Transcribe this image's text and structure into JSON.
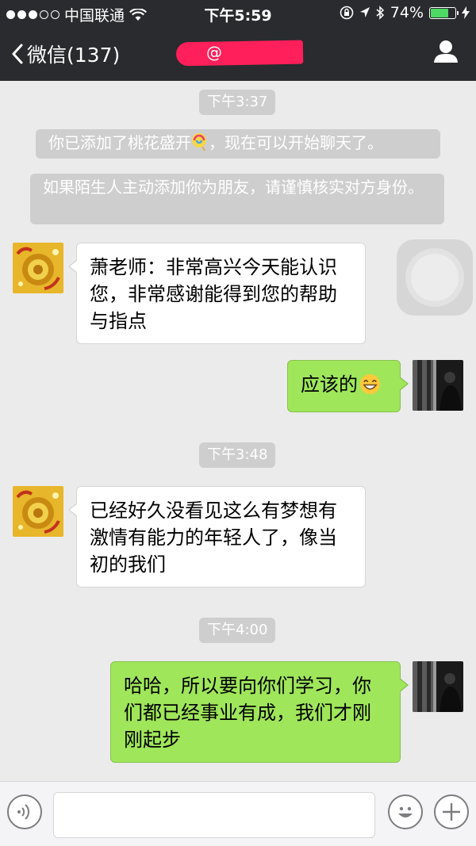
{
  "status_bar": {
    "carrier": "中国联通",
    "time": "下午5:59",
    "battery_percent": "74%",
    "battery_level": 0.74,
    "icons": [
      "signal-dots-icon",
      "wifi-icon",
      "orientation-lock-icon",
      "location-icon",
      "bluetooth-icon",
      "battery-icon",
      "charging-bolt-icon"
    ]
  },
  "nav": {
    "back_label": "微信(137)",
    "title_fragment": "@",
    "profile_icon": "person-icon"
  },
  "chat": {
    "timestamps": [
      "下午3:37",
      "下午3:48",
      "下午4:00"
    ],
    "system_messages": [
      {
        "text_before": "你已添加了桃花盛开",
        "emoji": "lollipop-emoji",
        "text_after": "，现在可以开始聊天了。"
      },
      {
        "text": "如果陌生人主动添加你为朋友，请谨慎核实对方身份。"
      }
    ],
    "messages": [
      {
        "side": "incoming",
        "text": "萧老师：非常高兴今天能认识您，非常感谢能得到您的帮助与指点"
      },
      {
        "side": "outgoing",
        "text": "应该的",
        "emoji": "grinning-face-emoji"
      },
      {
        "side": "incoming",
        "text": "已经好久没看见这么有梦想有激情有能力的年轻人了，像当初的我们"
      },
      {
        "side": "outgoing",
        "text": "哈哈，所以要向你们学习，你们都已经事业有成，我们才刚刚起步"
      }
    ]
  },
  "input_bar": {
    "text_value": "",
    "icons": [
      "voice-icon",
      "emoji-icon",
      "plus-icon"
    ]
  },
  "colors": {
    "topbar": "#2a2b2e",
    "chat_background": "#ebebeb",
    "outgoing_bubble": "#9fe65a",
    "incoming_bubble": "#ffffff",
    "system_chip": "#cecece",
    "redaction": "#ff1f5a"
  }
}
